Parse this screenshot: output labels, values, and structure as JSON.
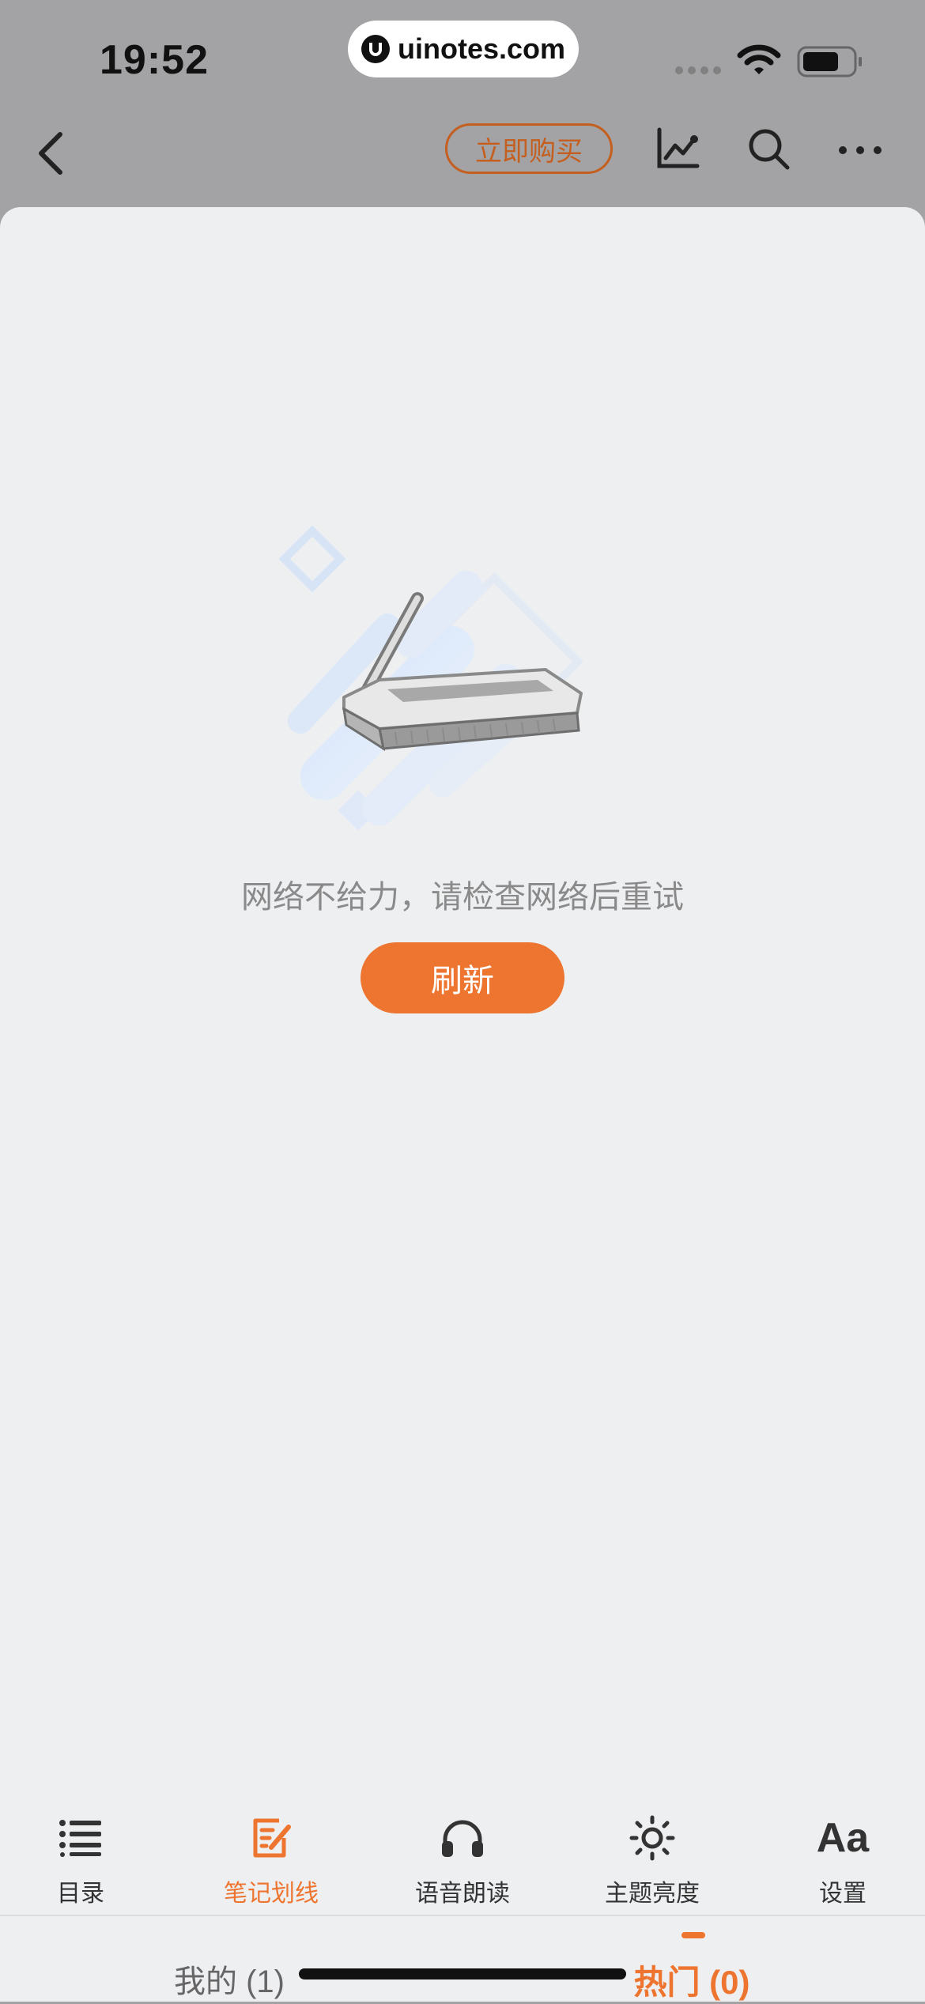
{
  "status_bar": {
    "time": "19:52",
    "url": "uinotes.com",
    "icons": [
      "cellular-signal-icon",
      "wifi-icon",
      "battery-icon"
    ]
  },
  "nav": {
    "buy_label": "立即购买",
    "icons": [
      "back-chevron-icon",
      "trend-chart-icon",
      "search-icon",
      "more-icon"
    ]
  },
  "content": {
    "error_message": "网络不给力，请检查网络后重试",
    "refresh_label": "刷新",
    "illustration": "offline-router-icon"
  },
  "tabs": {
    "mine": "我的 (1)",
    "hot": "热门 (0)",
    "active": "hot"
  },
  "toolbar": {
    "items": [
      {
        "label": "目录",
        "icon": "list-icon"
      },
      {
        "label": "笔记划线",
        "icon": "note-edit-icon"
      },
      {
        "label": "语音朗读",
        "icon": "headphones-icon"
      },
      {
        "label": "主题亮度",
        "icon": "brightness-icon"
      },
      {
        "label": "设置",
        "icon": "font-settings-icon"
      }
    ],
    "aa_text": "Aa"
  },
  "colors": {
    "accent": "#ed7530",
    "buy_outline": "#c55f1f",
    "header_bg": "#a3a3a5",
    "content_bg": "#eeeff1"
  }
}
